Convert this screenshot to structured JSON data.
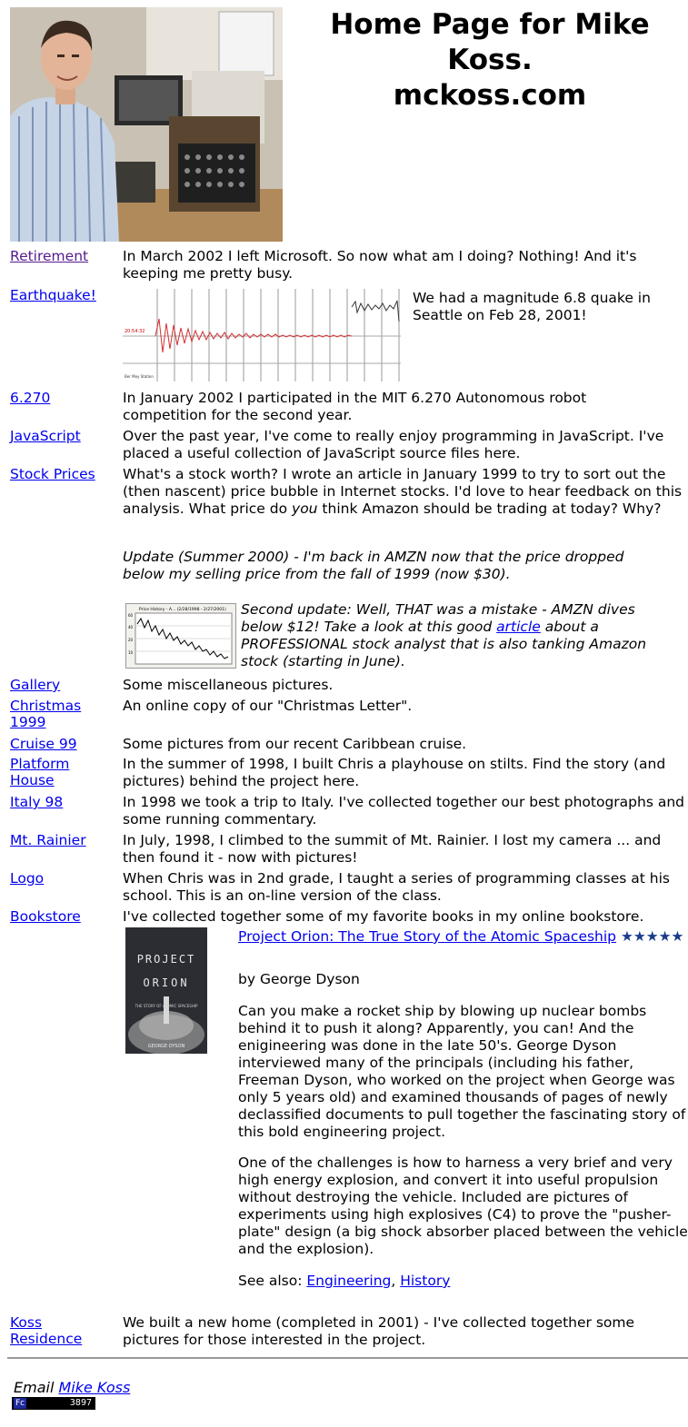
{
  "header": {
    "title_line1": "Home Page for Mike",
    "title_line2": "Koss.",
    "title_line3": "mckoss.com"
  },
  "rows": {
    "retirement": {
      "link": "Retirement",
      "desc": "In March 2002 I left Microsoft.  So now what am I doing?  Nothing!  And it's keeping me pretty busy."
    },
    "earthquake": {
      "link": "Earthquake!",
      "desc": "We had a magnitude 6.8 quake in Seattle on Feb 28, 2001!"
    },
    "mit": {
      "link": "6.270",
      "desc": "In January 2002 I participated in the MIT 6.270 Autonomous robot competition for the second year."
    },
    "javascript": {
      "link": "JavaScript",
      "desc": "Over the past year, I've come to really enjoy programming in JavaScript. I've placed a useful collection of JavaScript source files here."
    },
    "stock": {
      "link": "Stock Prices",
      "desc_a": "What's a stock worth?  I wrote an article in January 1999 to try to sort out the (then nascent) price bubble in Internet stocks.  I'd love to hear feedback on this analysis.  What price do ",
      "desc_em": "you",
      "desc_b": " think Amazon should be trading at today?  Why?",
      "update": "Update (Summer 2000) - I'm back in AMZN now that the price dropped below my selling price from the fall of 1999 (now $30).",
      "second_a": "Second update:  Well, THAT was a mistake - AMZN dives below $12!  Take a look at this good ",
      "second_link": "article",
      "second_b": " about a PROFESSIONAL stock analyst that is also tanking Amazon stock (starting in June).",
      "chart_title": "Price History - A... (2/28/1998 - 2/27/2001)"
    },
    "gallery": {
      "link": "Gallery",
      "desc": "Some miscellaneous pictures."
    },
    "christmas": {
      "link1": "Christmas",
      "link2": "1999",
      "desc": "An online copy of our \"Christmas Letter\"."
    },
    "cruise": {
      "link": "Cruise 99",
      "desc": "Some pictures from our recent Caribbean cruise."
    },
    "platform": {
      "link1": "Platform",
      "link2": "House",
      "desc": "In the summer of 1998, I built Chris a playhouse on stilts.  Find the story (and pictures) behind the project here."
    },
    "italy": {
      "link": "Italy 98",
      "desc": "In 1998 we took a trip to Italy.  I've collected together our best photographs and some running commentary."
    },
    "rainier": {
      "link": "Mt. Rainier",
      "desc": "In July, 1998, I climbed to the summit of Mt. Rainier.  I lost my camera ... and then found it - now with pictures!"
    },
    "logo": {
      "link": "Logo",
      "desc": "When Chris was in 2nd grade, I taught a series of programming classes at his school.  This is an on-line version of the class."
    },
    "bookstore": {
      "link": "Bookstore",
      "desc": "I've collected together some of my favorite books in my online bookstore.",
      "book_title": "Project Orion: The True Story of the Atomic Spaceship",
      "stars": "★★★★★",
      "author": "by George Dyson",
      "para1": "Can you make a rocket ship by blowing up nuclear bombs behind it to push it along? Apparently, you can! And the enigineering was done in the late 50's. George Dyson interviewed many of the principals (including his father, Freeman Dyson, who worked on the project when George was only 5 years old) and examined thousands of pages of newly declassified documents to pull together the fascinating story of this bold engineering project.",
      "para2": "One of the challenges is how to harness a very brief and very high energy explosion, and convert it into useful propulsion without destroying the vehicle. Included are pictures of experiments using high explosives (C4) to prove the \"pusher-plate\" design (a big shock absorber placed between the vehicle and the explosion).",
      "see_also": "See also: ",
      "see_link1": "Engineering",
      "see_sep": ", ",
      "see_link2": "History",
      "cover_line1": "PROJECT",
      "cover_line2": "ORION",
      "cover_sub": "THE STORY OF ATOMIC SPACESHIP",
      "cover_author": "GEORGE DYSON"
    },
    "residence": {
      "link1": "Koss",
      "link2": "Residence",
      "desc": "We built a new home (completed in 2001) - I've collected together some pictures for those interested in the project."
    }
  },
  "footer": {
    "email_label": "Email ",
    "email_link": "Mike Koss",
    "counter_badge": "Fc",
    "counter_value": "3897"
  },
  "colors": {
    "link": "#0000ee",
    "visited": "#551a8b",
    "quake_trace": "#d23030",
    "star": "#1a3c8c"
  }
}
